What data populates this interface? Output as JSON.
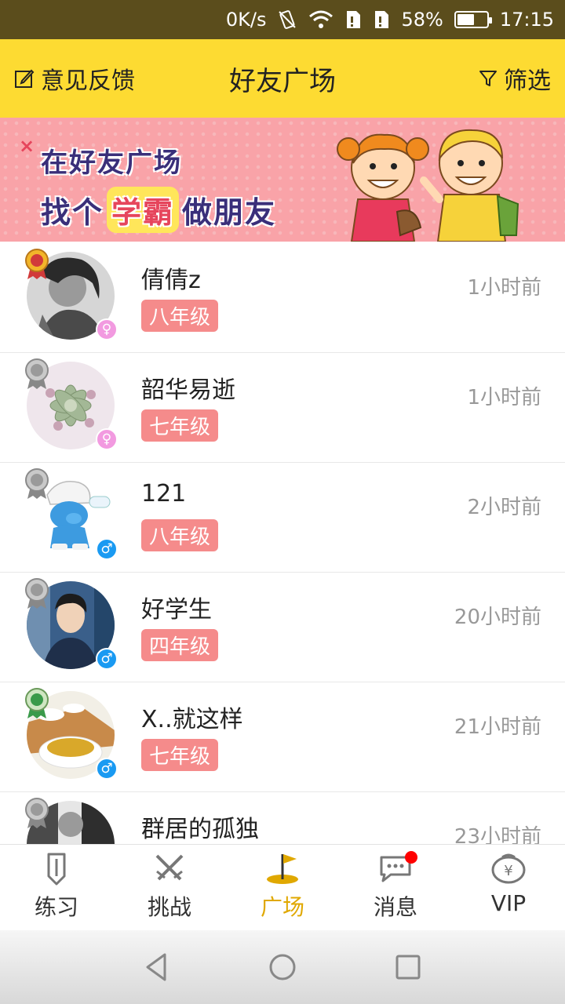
{
  "status_bar": {
    "speed": "0K/s",
    "battery": "58%",
    "battery_level": 0.58,
    "time": "17:15"
  },
  "header": {
    "feedback_label": "意见反馈",
    "title": "好友广场",
    "filter_label": "筛选"
  },
  "banner": {
    "line1": "在好友广场",
    "line2_pre": "找个",
    "line2_highlight": "学霸",
    "line2_post": "做朋友"
  },
  "friends": [
    {
      "name": "倩倩z",
      "grade": "八年级",
      "time": "1小时前",
      "gender": "female",
      "gender_symbol": "♀",
      "medal": "gold"
    },
    {
      "name": "韶华易逝",
      "grade": "七年级",
      "time": "1小时前",
      "gender": "female",
      "gender_symbol": "♀",
      "medal": "silver"
    },
    {
      "name": "121",
      "grade": "八年级",
      "time": "2小时前",
      "gender": "male",
      "gender_symbol": "♂",
      "medal": "silver"
    },
    {
      "name": "好学生",
      "grade": "四年级",
      "time": "20小时前",
      "gender": "male",
      "gender_symbol": "♂",
      "medal": "silver"
    },
    {
      "name": "X..就这样",
      "grade": "七年级",
      "time": "21小时前",
      "gender": "male",
      "gender_symbol": "♂",
      "medal": "green"
    },
    {
      "name": "群居的孤独",
      "grade": "",
      "time": "23小时前",
      "gender": "",
      "gender_symbol": "",
      "medal": "silver"
    }
  ],
  "tabs": [
    {
      "label": "练习",
      "icon": "pencil-icon"
    },
    {
      "label": "挑战",
      "icon": "crossed-swords-icon"
    },
    {
      "label": "广场",
      "icon": "flag-icon",
      "active": true
    },
    {
      "label": "消息",
      "icon": "chat-bubble-icon",
      "badge": true
    },
    {
      "label": "VIP",
      "icon": "yen-badge-icon"
    }
  ],
  "colors": {
    "header": "#fddb32",
    "accent": "#e0a800",
    "grade_badge": "#f58b8b",
    "female": "#f29ae0",
    "male": "#1a9af2"
  }
}
